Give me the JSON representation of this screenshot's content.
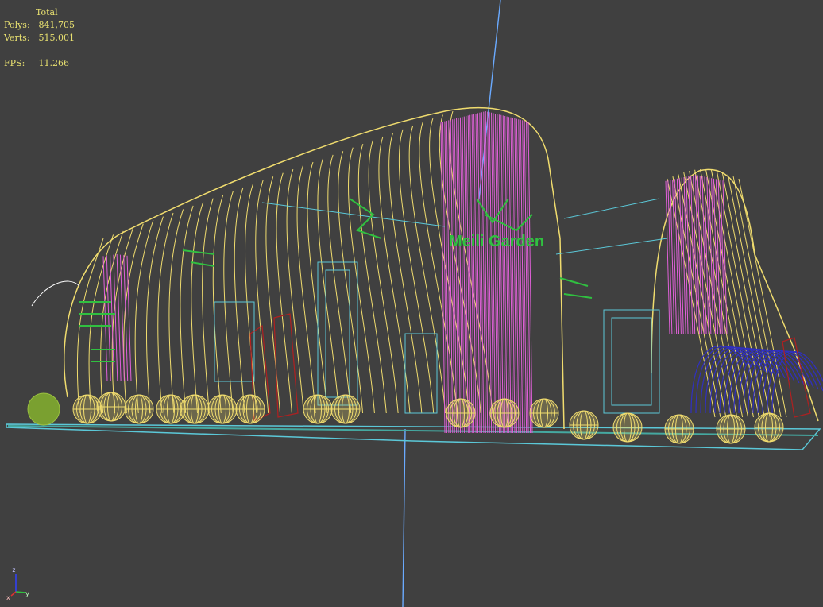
{
  "viewport": {
    "stats": {
      "total_label": "Total",
      "polys_label": "Polys:",
      "polys_value": "841,705",
      "verts_label": "Verts:",
      "verts_value": "515,001",
      "fps_label": "FPS:",
      "fps_value": "11.266"
    },
    "gizmo": {
      "x_label": "x",
      "y_label": "y",
      "z_label": "z"
    },
    "sign_text": "Meili Garden"
  },
  "colors": {
    "background": "#404040",
    "stats_text": "#e8e070",
    "wire_yellow": "#f0dc6e",
    "wire_pink": "#e060d8",
    "wire_green": "#30c040",
    "wire_cyan": "#5bc8d8",
    "wire_blue": "#3030c0",
    "wire_red": "#b02020",
    "axis_blue": "#6aaaff"
  }
}
